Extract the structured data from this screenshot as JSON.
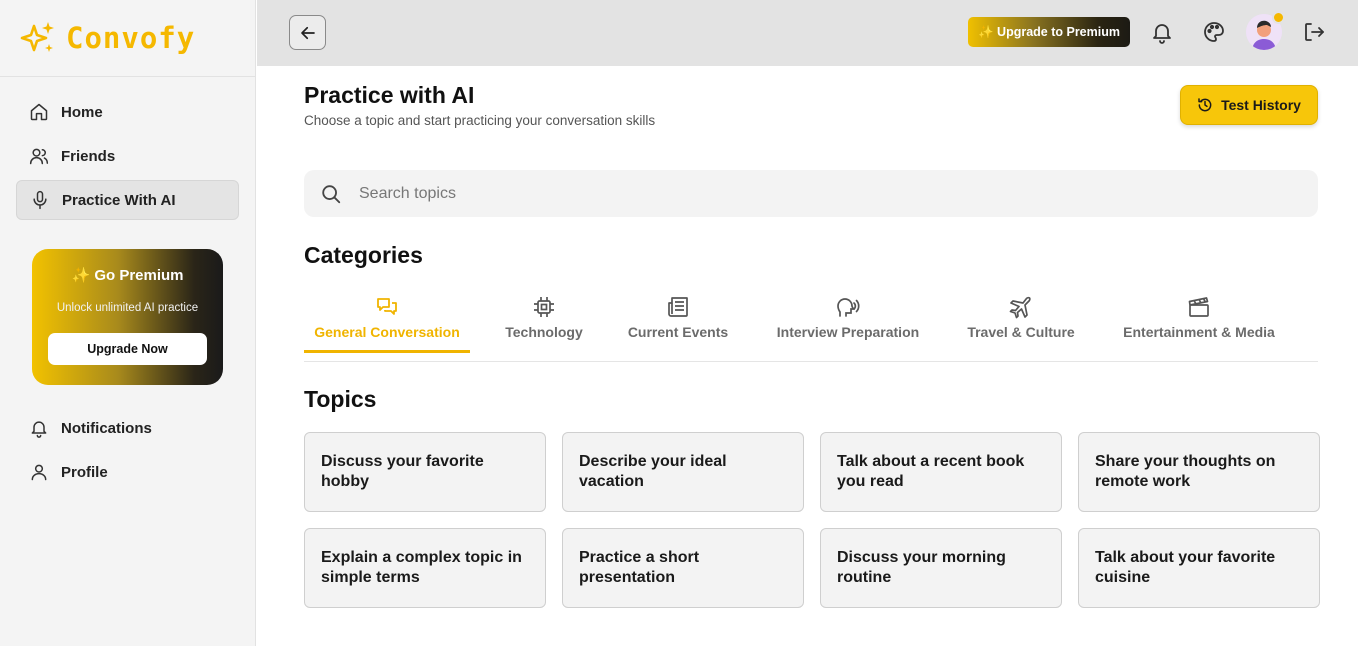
{
  "brand": {
    "name": "Convofy",
    "accent": "#f5b800"
  },
  "sidebar": {
    "items": [
      {
        "label": "Home",
        "icon": "home-icon"
      },
      {
        "label": "Friends",
        "icon": "users-icon"
      },
      {
        "label": "Practice With AI",
        "icon": "microphone-icon",
        "active": true
      }
    ],
    "premium": {
      "title": "✨ Go Premium",
      "subtitle": "Unlock unlimited AI practice",
      "button": "Upgrade Now"
    },
    "bottom_items": [
      {
        "label": "Notifications",
        "icon": "bell-icon"
      },
      {
        "label": "Profile",
        "icon": "user-icon"
      }
    ]
  },
  "topbar": {
    "upgrade_label": "✨ Upgrade to Premium",
    "icons": [
      "back-arrow-icon",
      "bell-icon",
      "palette-icon",
      "avatar",
      "logout-icon"
    ]
  },
  "main": {
    "title": "Practice with AI",
    "subtitle": "Choose a topic and start practicing your conversation skills",
    "history_button": "Test History",
    "search_placeholder": "Search topics",
    "categories_heading": "Categories",
    "tabs": [
      {
        "label": "General Conversation",
        "icon": "chat-bubbles-icon",
        "active": true
      },
      {
        "label": "Technology",
        "icon": "cpu-chip-icon"
      },
      {
        "label": "Current Events",
        "icon": "newspaper-icon"
      },
      {
        "label": "Interview Preparation",
        "icon": "speaking-head-icon"
      },
      {
        "label": "Travel & Culture",
        "icon": "airplane-icon"
      },
      {
        "label": "Entertainment & Media",
        "icon": "clapperboard-icon"
      }
    ],
    "topics_heading": "Topics",
    "topics": [
      "Discuss your favorite hobby",
      "Describe your ideal vacation",
      "Talk about a recent book you read",
      "Share your thoughts on remote work",
      "Explain a complex topic in simple terms",
      "Practice a short presentation",
      "Discuss your morning routine",
      "Talk about your favorite cuisine"
    ]
  }
}
